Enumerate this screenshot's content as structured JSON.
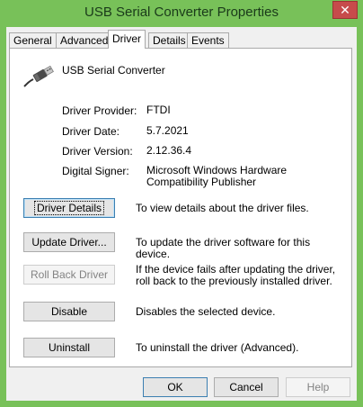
{
  "window": {
    "title": "USB Serial Converter Properties",
    "close_glyph": "✕"
  },
  "tabs": [
    {
      "label": "General"
    },
    {
      "label": "Advanced"
    },
    {
      "label": "Driver",
      "active": true
    },
    {
      "label": "Details"
    },
    {
      "label": "Events"
    }
  ],
  "device": {
    "name": "USB Serial Converter",
    "icon": "usb-plug-icon"
  },
  "info": {
    "provider_label": "Driver Provider:",
    "provider_value": "FTDI",
    "date_label": "Driver Date:",
    "date_value": "5.7.2021",
    "version_label": "Driver Version:",
    "version_value": "2.12.36.4",
    "signer_label": "Digital Signer:",
    "signer_value": "Microsoft Windows Hardware Compatibility Publisher"
  },
  "actions": {
    "details_button": "Driver Details",
    "details_desc": "To view details about the driver files.",
    "update_button": "Update Driver...",
    "update_desc": "To update the driver software for this device.",
    "rollback_button": "Roll Back Driver",
    "rollback_desc": "If the device fails after updating the driver, roll back to the previously installed driver.",
    "disable_button": "Disable",
    "disable_desc": "Disables the selected device.",
    "uninstall_button": "Uninstall",
    "uninstall_desc": "To uninstall the driver (Advanced)."
  },
  "footer": {
    "ok": "OK",
    "cancel": "Cancel",
    "help": "Help"
  },
  "colors": {
    "frame": "#78c159",
    "close": "#c74b4b"
  }
}
